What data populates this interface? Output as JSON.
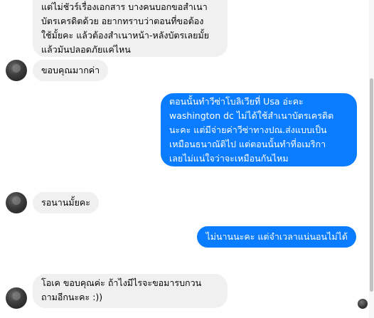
{
  "messages": [
    {
      "direction": "incoming",
      "text": "แต่ไม่ชัวร์เรื่องเอกสาร บางคนบอกขอสำเนา\nบัตรเครดิตด้วย อยากทราบว่าตอนที่ขอต้อง\nใช้มั้ยคะ แล้วต้องสำเนาหน้า-หลังบัตรเลยมั้ย\nแล้วมันปลอดภัยแค่ไหน"
    },
    {
      "direction": "incoming",
      "text": "ขอบคุณมากค่า"
    },
    {
      "direction": "outgoing",
      "text": "ตอนนั้นทำวีซ่าโบลิเวียที่ Usa อ่ะคะ\nwashington dc  ไม่ได้ใช้สำเนาบัตรเครดิต\nนะคะ แต่มีจ่ายค่าวีซ่าทางปณ.ส่งแบบเป็น\nเหมือนธนาณัติไป แต่ตอนนั้นทำที่อเมริกา\nเลยไม่แน่ใจว่าจะเหมือนกันไหม"
    },
    {
      "direction": "incoming",
      "text": "รอนานมั้ยคะ"
    },
    {
      "direction": "outgoing",
      "text": "ไม่นานนะคะ แต่จำเวลาแน่นอนไม่ได้"
    },
    {
      "direction": "incoming",
      "text": "โอเค ขอบคุณค่ะ ถ้าไงมีไรจะขอมารบกวน\nถามอีกนะคะ :))"
    }
  ],
  "colors": {
    "incoming_bubble": "#f0f0f0",
    "outgoing_bubble": "#0a7cff"
  }
}
